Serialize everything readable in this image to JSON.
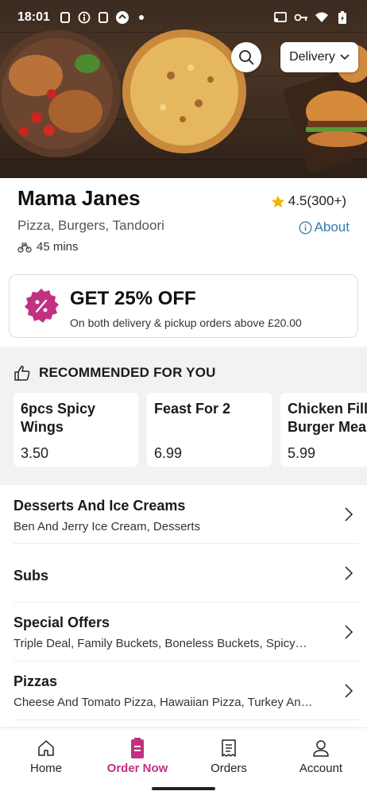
{
  "status_bar": {
    "time": "18:01"
  },
  "header": {
    "delivery_mode": "Delivery"
  },
  "restaurant": {
    "name": "Mama Janes",
    "rating": "4.5(300+)",
    "cuisines": "Pizza, Burgers, Tandoori",
    "about_label": "About",
    "eta": "45 mins"
  },
  "offer": {
    "title": "GET 25% OFF",
    "subtitle": "On both delivery & pickup orders above £20.00"
  },
  "recommended": {
    "heading": "RECOMMENDED FOR YOU",
    "items": [
      {
        "name": "6pcs Spicy Wings",
        "price": "3.50"
      },
      {
        "name": "Feast For 2",
        "price": "6.99"
      },
      {
        "name": "Chicken Fillet Burger Meal",
        "price": "5.99"
      }
    ]
  },
  "categories": [
    {
      "title": "Desserts And Ice Creams",
      "description": "Ben And Jerry Ice Cream, Desserts"
    },
    {
      "title": "Subs",
      "description": ""
    },
    {
      "title": "Special Offers",
      "description": "Triple Deal, Family Buckets, Boneless Buckets, Spicy…"
    },
    {
      "title": "Pizzas",
      "description": "Cheese And Tomato Pizza, Hawaiian Pizza, Turkey An…"
    }
  ],
  "bottom_nav": [
    {
      "label": "Home",
      "icon": "home-icon"
    },
    {
      "label": "Order Now",
      "icon": "order-now-icon",
      "active": true
    },
    {
      "label": "Orders",
      "icon": "receipt-icon"
    },
    {
      "label": "Account",
      "icon": "person-icon"
    }
  ],
  "colors": {
    "accent": "#c2307f",
    "link": "#2f7db5",
    "star": "#f5b400"
  }
}
